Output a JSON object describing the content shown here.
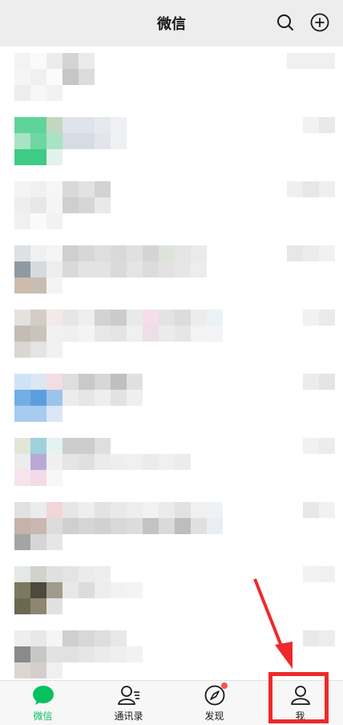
{
  "header": {
    "title": "微信",
    "search_icon": "search-icon",
    "add_icon": "plus-circle-icon"
  },
  "tabbar": {
    "items": [
      {
        "label": "微信",
        "icon": "chat-bubble-icon",
        "active": true
      },
      {
        "label": "通讯录",
        "icon": "contacts-icon",
        "active": false
      },
      {
        "label": "发现",
        "icon": "compass-icon",
        "active": false,
        "badge_dot": true
      },
      {
        "label": "我",
        "icon": "person-icon",
        "active": false
      }
    ]
  },
  "annotation": {
    "box_color": "#ee2a2a",
    "arrow_color": "#ee2a2a"
  },
  "colors": {
    "active_tab": "#07c160",
    "header_bg": "#ededed",
    "tabbar_bg": "#f7f7f7",
    "badge_red": "#fa5151"
  },
  "chat_rows": [
    {
      "avatar": [
        "#f3f3f3",
        "#fafafa",
        "#ececec",
        "#f5f5f5",
        "#f0f0f0",
        "#fbfbfb",
        "#eeeeee",
        "#f7f7f7",
        "#f2f2f2"
      ],
      "name": [
        "#d4d4d4",
        "#ebebeb"
      ],
      "name2": [
        "#c6c6c6",
        "#dcdcdc"
      ],
      "time": [
        "#f0f0f0",
        "#f0f0f0",
        "#f0f0f0"
      ]
    },
    {
      "avatar": [
        "#5fd49a",
        "#5fd49a",
        "#c3d6c0",
        "#a8e3c4",
        "#6fd6a2",
        "#a8e3c4",
        "#3ecb86",
        "#3ecb86",
        "#e3f2ea"
      ],
      "name": [
        "#dfe3ea",
        "#dfe3ea",
        "#e6e9ee",
        "#eef0f3"
      ],
      "name2": [
        "#d6dbe4",
        "#d6dbe4",
        "#e2e5ea",
        "#eef0f3"
      ],
      "time": [
        "#f2f2f2",
        "#e9e9e9"
      ]
    },
    {
      "avatar": [
        "#f4f4f4",
        "#f0f0f0",
        "#f6f6f6",
        "#eeeeee",
        "#e7e7e7",
        "#f5f5f5",
        "#f0f0f0",
        "#fafafa",
        "#f2f2f2"
      ],
      "name": [
        "#d9d9d9",
        "#e2e2e2",
        "#d3d3d3"
      ],
      "name2": [
        "#cfcfcf",
        "#d6d6d6",
        "#e9e9e9"
      ],
      "time": [
        "#efefef",
        "#e7e7e7",
        "#efefef"
      ]
    },
    {
      "avatar": [
        "#dde1e4",
        "#eef0f1",
        "#f5f5f5",
        "#8d9aa3",
        "#d7dadc",
        "#eceeee",
        "#cdbcaa",
        "#c7bdb3",
        "#f4f4f4"
      ],
      "name": [
        "#cfcfcf",
        "#d7d7d7",
        "#dedede",
        "#d9d9d9",
        "#e0e0e0",
        "#d4d4d4",
        "#dde3da",
        "#e5e5e5",
        "#e9ebe8"
      ],
      "name2": [
        "#d9d9d9",
        "#e3e3e3",
        "#e3e3e3",
        "#dadada",
        "#e4e4e4",
        "#dcdcdc",
        "#e2e2e2",
        "#e6e6e6",
        "#ededed"
      ],
      "time": [
        "#e7e7e7",
        "#ececec",
        "#f1f1f1"
      ]
    },
    {
      "avatar": [
        "#e4e2df",
        "#d3cdc5",
        "#f5e8e8",
        "#c3bdb6",
        "#c9c3bc",
        "#f0f0f0",
        "#dad6d1",
        "#e4e4e4",
        "#f1f1f1"
      ],
      "name": [
        "#e6e6e6",
        "#eeeeee",
        "#d2d2d2",
        "#cbcbcb",
        "#e9e9e9",
        "#f7dde9",
        "#e3e3e3",
        "#dcdcdc",
        "#ececec",
        "#eaf2f5"
      ],
      "name2": [
        "#efefef",
        "#f4f4f4",
        "#e7e7e7",
        "#e4e4e4",
        "#f0f0f0",
        "#ecdfe5",
        "#ebebeb",
        "#e6e6e6",
        "#f3f3f3",
        "#f2f4f5"
      ],
      "time": [
        "#f1f1f1",
        "#eaeaea"
      ]
    },
    {
      "avatar": [
        "#cfe3f6",
        "#dbe7f4",
        "#f2dde2",
        "#72aee4",
        "#5c9fe0",
        "#9cc3ec",
        "#a8cbf0",
        "#a8cbf0",
        "#dbe7f4"
      ],
      "name": [
        "#dedede",
        "#c9c9c9",
        "#d7d7d7",
        "#bfbfbf",
        "#e0e0e0"
      ],
      "name2": [
        "#ececec",
        "#e6e6e6",
        "#eeeeee",
        "#e2e2e2",
        "#efefef"
      ],
      "time": [
        "#ececec",
        "#e4e4e4"
      ]
    },
    {
      "avatar": [
        "#e2e6d6",
        "#9fd0de",
        "#e4f2f1",
        "#ececec",
        "#b9a9d6",
        "#f0f0f0",
        "#f7e3ea",
        "#f2dbe6",
        "#f7f7f7"
      ],
      "name": [
        "#cdcdcd",
        "#cdcdcd",
        "#dedede"
      ],
      "name2": [
        "#e5e5e5",
        "#e0e0e0",
        "#ebebeb",
        "#eeeeee",
        "#f0f0f0",
        "#ebebeb",
        "#f0f0f0",
        "#ececec"
      ],
      "time": [
        "#f1f1f1",
        "#ececec"
      ]
    },
    {
      "avatar": [
        "#e1e1e1",
        "#ececec",
        "#f1d5d8",
        "#c6b2aa",
        "#c9b7b0",
        "#dcdcdc",
        "#a4a4a4",
        "#d6d6d6",
        "#e6e6e6"
      ],
      "name": [
        "#e6e6e6",
        "#eeeeee",
        "#e3e3e3",
        "#e9e9e9",
        "#ededed",
        "#f2f2f2",
        "#ebebeb",
        "#e2e2e2",
        "#f0f0f0",
        "#eef2f4"
      ],
      "name2": [
        "#cfcfcf",
        "#d5d5d5",
        "#d1d1d1",
        "#d8d8d8",
        "#dcdcdc",
        "#c3c3c3",
        "#dadada",
        "#bdbdbd",
        "#e0e0e0",
        "#e8eef2"
      ],
      "time": [
        "#e7e7e7",
        "#f1f1f1"
      ]
    },
    {
      "avatar": [
        "#e4e8e6",
        "#cfd3cc",
        "#e0e0e0",
        "#7b7a5f",
        "#4c4a3c",
        "#a19c8a",
        "#6b684f",
        "#8e8672",
        "#e1e1e1"
      ],
      "name": [
        "#e4e4e4",
        "#ebebeb",
        "#eeeeee"
      ],
      "name2": [
        "#e8e8e8",
        "#dcdcdc",
        "#ededed",
        "#f2f2f2",
        "#f4f4f4"
      ],
      "time": [
        "#f2f2f2",
        "#f0f0f0"
      ]
    },
    {
      "avatar": [
        "#eeeeee",
        "#e8e8e8",
        "#f5f5f5",
        "#8a8a8a",
        "#c7c7c7",
        "#e2e2e2",
        "#dcd6d3",
        "#d4cfcd",
        "#f0f0f0"
      ],
      "name": [
        "#cfcfcf",
        "#d8d8d8",
        "#dedede",
        "#e8e8e8"
      ],
      "name2": [
        "#e1e1e1",
        "#e6e6e6",
        "#ebebeb",
        "#efefef",
        "#f2f2f2"
      ],
      "time": [
        "#e9e9e9",
        "#ededed"
      ]
    }
  ]
}
